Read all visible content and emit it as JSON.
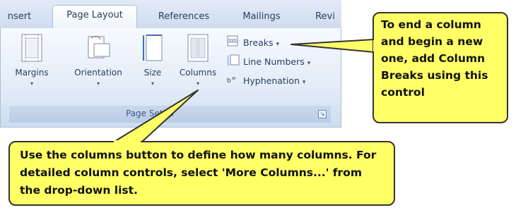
{
  "ribbon": {
    "tabs": [
      {
        "label": "nsert"
      },
      {
        "label": "Page Layout"
      },
      {
        "label": "References"
      },
      {
        "label": "Mailings"
      },
      {
        "label": "Revi"
      }
    ],
    "group_label": "Page Setup",
    "big_buttons": [
      {
        "label": "Margins",
        "icon": "margins-icon"
      },
      {
        "label": "Orientation",
        "icon": "orientation-icon"
      },
      {
        "label": "Size",
        "icon": "size-icon"
      },
      {
        "label": "Columns",
        "icon": "columns-icon"
      }
    ],
    "small_buttons": [
      {
        "label": "Breaks",
        "icon": "breaks-icon"
      },
      {
        "label": "Line Numbers",
        "icon": "line-numbers-icon"
      },
      {
        "label": "Hyphenation",
        "icon": "hyphenation-icon"
      }
    ],
    "dropdown_arrow": "▾",
    "launcher_glyph": "↘"
  },
  "callouts": {
    "right_text": "To end a column and begin a new one, add Column Breaks using this control",
    "bottom_text": "Use the columns button to define how many columns. For detailed column controls, select 'More Columns...' from the drop-down list."
  },
  "colors": {
    "callout_fill": "#ffff66",
    "ribbon_blue": "#dfe9f6"
  }
}
